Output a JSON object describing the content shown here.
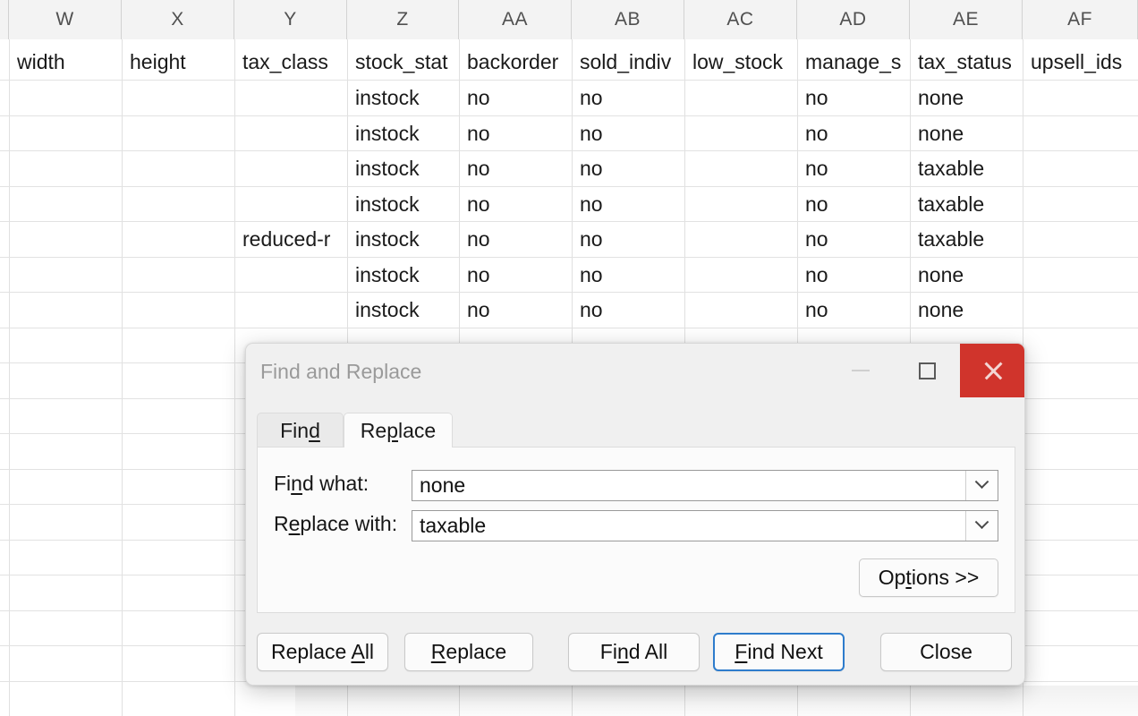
{
  "spreadsheet": {
    "column_letters": [
      "W",
      "X",
      "Y",
      "Z",
      "AA",
      "AB",
      "AC",
      "AD",
      "AE",
      "AF"
    ],
    "header_row": [
      "width",
      "height",
      "tax_class",
      "stock_stat",
      "backorder",
      "sold_indiv",
      "low_stock",
      "manage_s",
      "tax_status",
      "upsell_ids"
    ],
    "rows": [
      {
        "width": "",
        "height": "",
        "tax_class": "",
        "stock_status": "instock",
        "backorders": "no",
        "sold_individually": "no",
        "low_stock": "",
        "manage_stock": "no",
        "tax_status": "none",
        "upsell_ids": ""
      },
      {
        "width": "",
        "height": "",
        "tax_class": "",
        "stock_status": "instock",
        "backorders": "no",
        "sold_individually": "no",
        "low_stock": "",
        "manage_stock": "no",
        "tax_status": "none",
        "upsell_ids": ""
      },
      {
        "width": "",
        "height": "",
        "tax_class": "",
        "stock_status": "instock",
        "backorders": "no",
        "sold_individually": "no",
        "low_stock": "",
        "manage_stock": "no",
        "tax_status": "taxable",
        "upsell_ids": ""
      },
      {
        "width": "",
        "height": "",
        "tax_class": "",
        "stock_status": "instock",
        "backorders": "no",
        "sold_individually": "no",
        "low_stock": "",
        "manage_stock": "no",
        "tax_status": "taxable",
        "upsell_ids": ""
      },
      {
        "width": "",
        "height": "",
        "tax_class": "reduced-r",
        "stock_status": "instock",
        "backorders": "no",
        "sold_individually": "no",
        "low_stock": "",
        "manage_stock": "no",
        "tax_status": "taxable",
        "upsell_ids": ""
      },
      {
        "width": "",
        "height": "",
        "tax_class": "",
        "stock_status": "instock",
        "backorders": "no",
        "sold_individually": "no",
        "low_stock": "",
        "manage_stock": "no",
        "tax_status": "none",
        "upsell_ids": ""
      },
      {
        "width": "",
        "height": "",
        "tax_class": "",
        "stock_status": "instock",
        "backorders": "no",
        "sold_individually": "no",
        "low_stock": "",
        "manage_stock": "no",
        "tax_status": "none",
        "upsell_ids": ""
      }
    ]
  },
  "dialog": {
    "title": "Find and Replace",
    "window_controls": {
      "minimize": "minimize-icon",
      "maximize": "maximize-icon",
      "close": "close-icon",
      "close_color": "#d0342c"
    },
    "tabs": [
      {
        "label": "Find",
        "accel": "d",
        "active": false
      },
      {
        "label": "Replace",
        "accel": "p",
        "active": true
      }
    ],
    "fields": {
      "find_label_pre": "Fi",
      "find_label_accel": "n",
      "find_label_post": "d what:",
      "find_value": "none",
      "replace_label_pre": "R",
      "replace_label_accel": "e",
      "replace_label_post": "place with:",
      "replace_value": "taxable",
      "dropdown_icon": "chevron-down-icon"
    },
    "options_button": {
      "pre": "Op",
      "accel": "t",
      "post": "ions >>"
    },
    "buttons": [
      {
        "pre": "Replace ",
        "accel": "A",
        "post": "ll",
        "focused": false
      },
      {
        "pre": "",
        "accel": "R",
        "post": "eplace",
        "focused": false
      },
      {
        "pre": "Fi",
        "accel": "n",
        "post": "d All",
        "focused": false
      },
      {
        "pre": "",
        "accel": "F",
        "post": "ind Next",
        "focused": true
      },
      {
        "pre": "Close",
        "accel": "",
        "post": "",
        "focused": false
      }
    ],
    "focus_color": "#2e7ccc"
  }
}
